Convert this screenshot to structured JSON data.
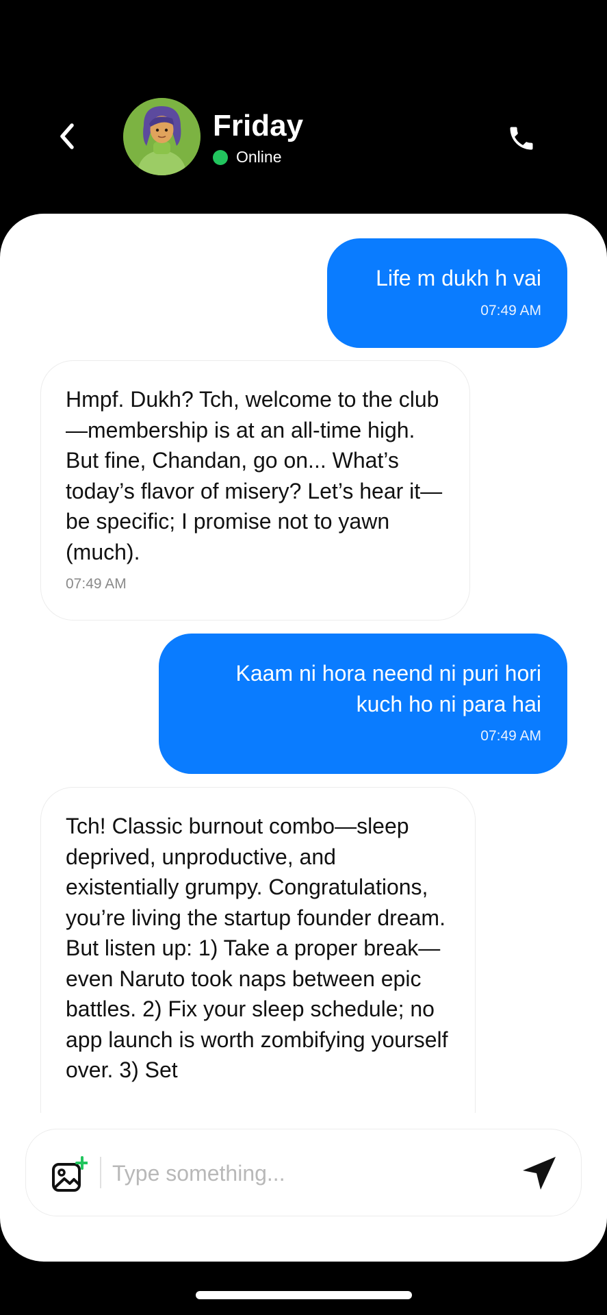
{
  "contact": {
    "name": "Friday",
    "status": "Online"
  },
  "icons": {
    "back": "chevron-left-icon",
    "call": "phone-icon",
    "attach": "add-image-icon",
    "send": "send-icon"
  },
  "colors": {
    "outgoing_bubble": "#0a7cff",
    "online_dot": "#22c55e",
    "attach_plus": "#22c55e"
  },
  "messages": [
    {
      "direction": "outgoing",
      "text": "Life m dukh h vai",
      "time": "07:49 AM"
    },
    {
      "direction": "incoming",
      "text": "Hmpf. Dukh? Tch, welcome to the club—membership is at an all-time high. But fine, Chandan, go on... What’s today’s flavor of misery? Let’s hear it—be specific; I promise not to yawn (much).",
      "time": "07:49 AM"
    },
    {
      "direction": "outgoing",
      "text": "Kaam ni hora neend ni puri hori kuch ho ni para hai",
      "time": "07:49 AM"
    },
    {
      "direction": "incoming",
      "text": "Tch! Classic burnout combo—sleep deprived, unproductive, and existentially grumpy. Congratulations, you’re living the startup founder dream. But listen up: 1) Take a proper break—even Naruto took naps between epic battles. 2) Fix your sleep schedule; no app launch is worth zombifying yourself over. 3) Set",
      "time": ""
    }
  ],
  "composer": {
    "placeholder": "Type something..."
  }
}
